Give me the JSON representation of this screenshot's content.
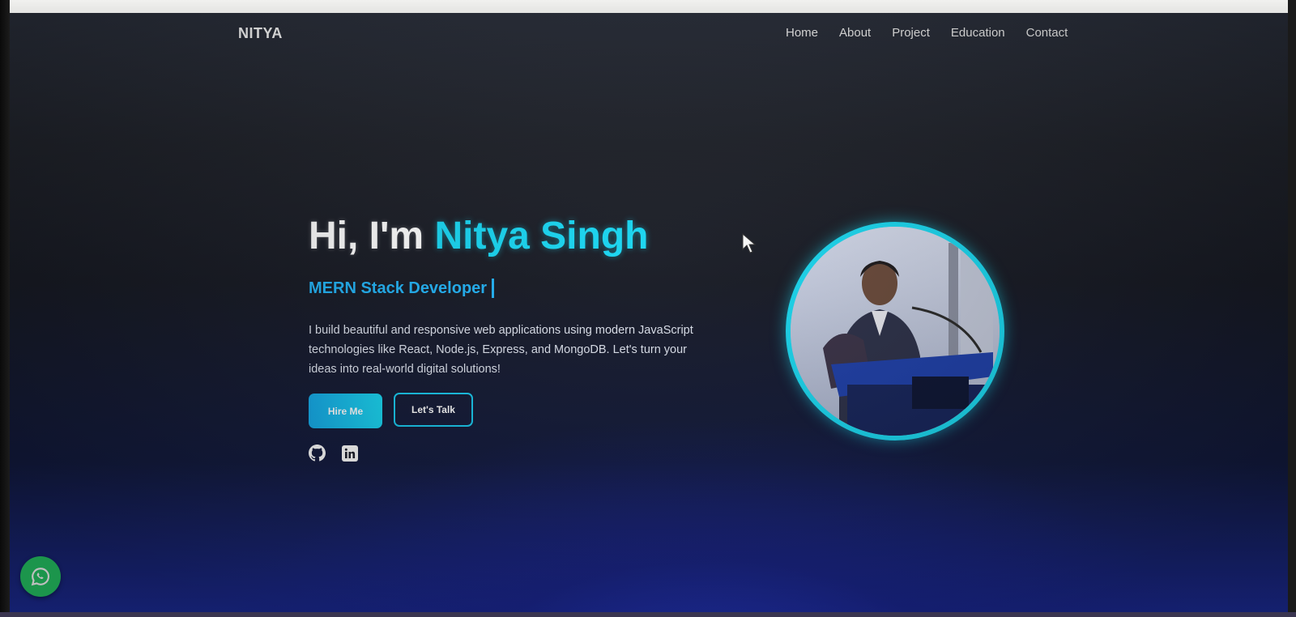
{
  "nav": {
    "brand": "NITYA",
    "links": [
      "Home",
      "About",
      "Project",
      "Education",
      "Contact"
    ]
  },
  "hero": {
    "greeting": "Hi, I'm",
    "name": "Nitya Singh",
    "role": "MERN Stack Developer",
    "description": "I build beautiful and responsive web applications using modern JavaScript technologies like React, Node.js, Express, and MongoDB. Let's turn your ideas into real-world digital solutions!",
    "primary_button": "Hire Me",
    "secondary_button": "Let's Talk"
  },
  "socials": {
    "icons": [
      "github-icon",
      "linkedin-icon"
    ]
  },
  "colors": {
    "accent": "#18d6f2",
    "role_text": "#22b4f7",
    "whatsapp": "#25c766"
  }
}
